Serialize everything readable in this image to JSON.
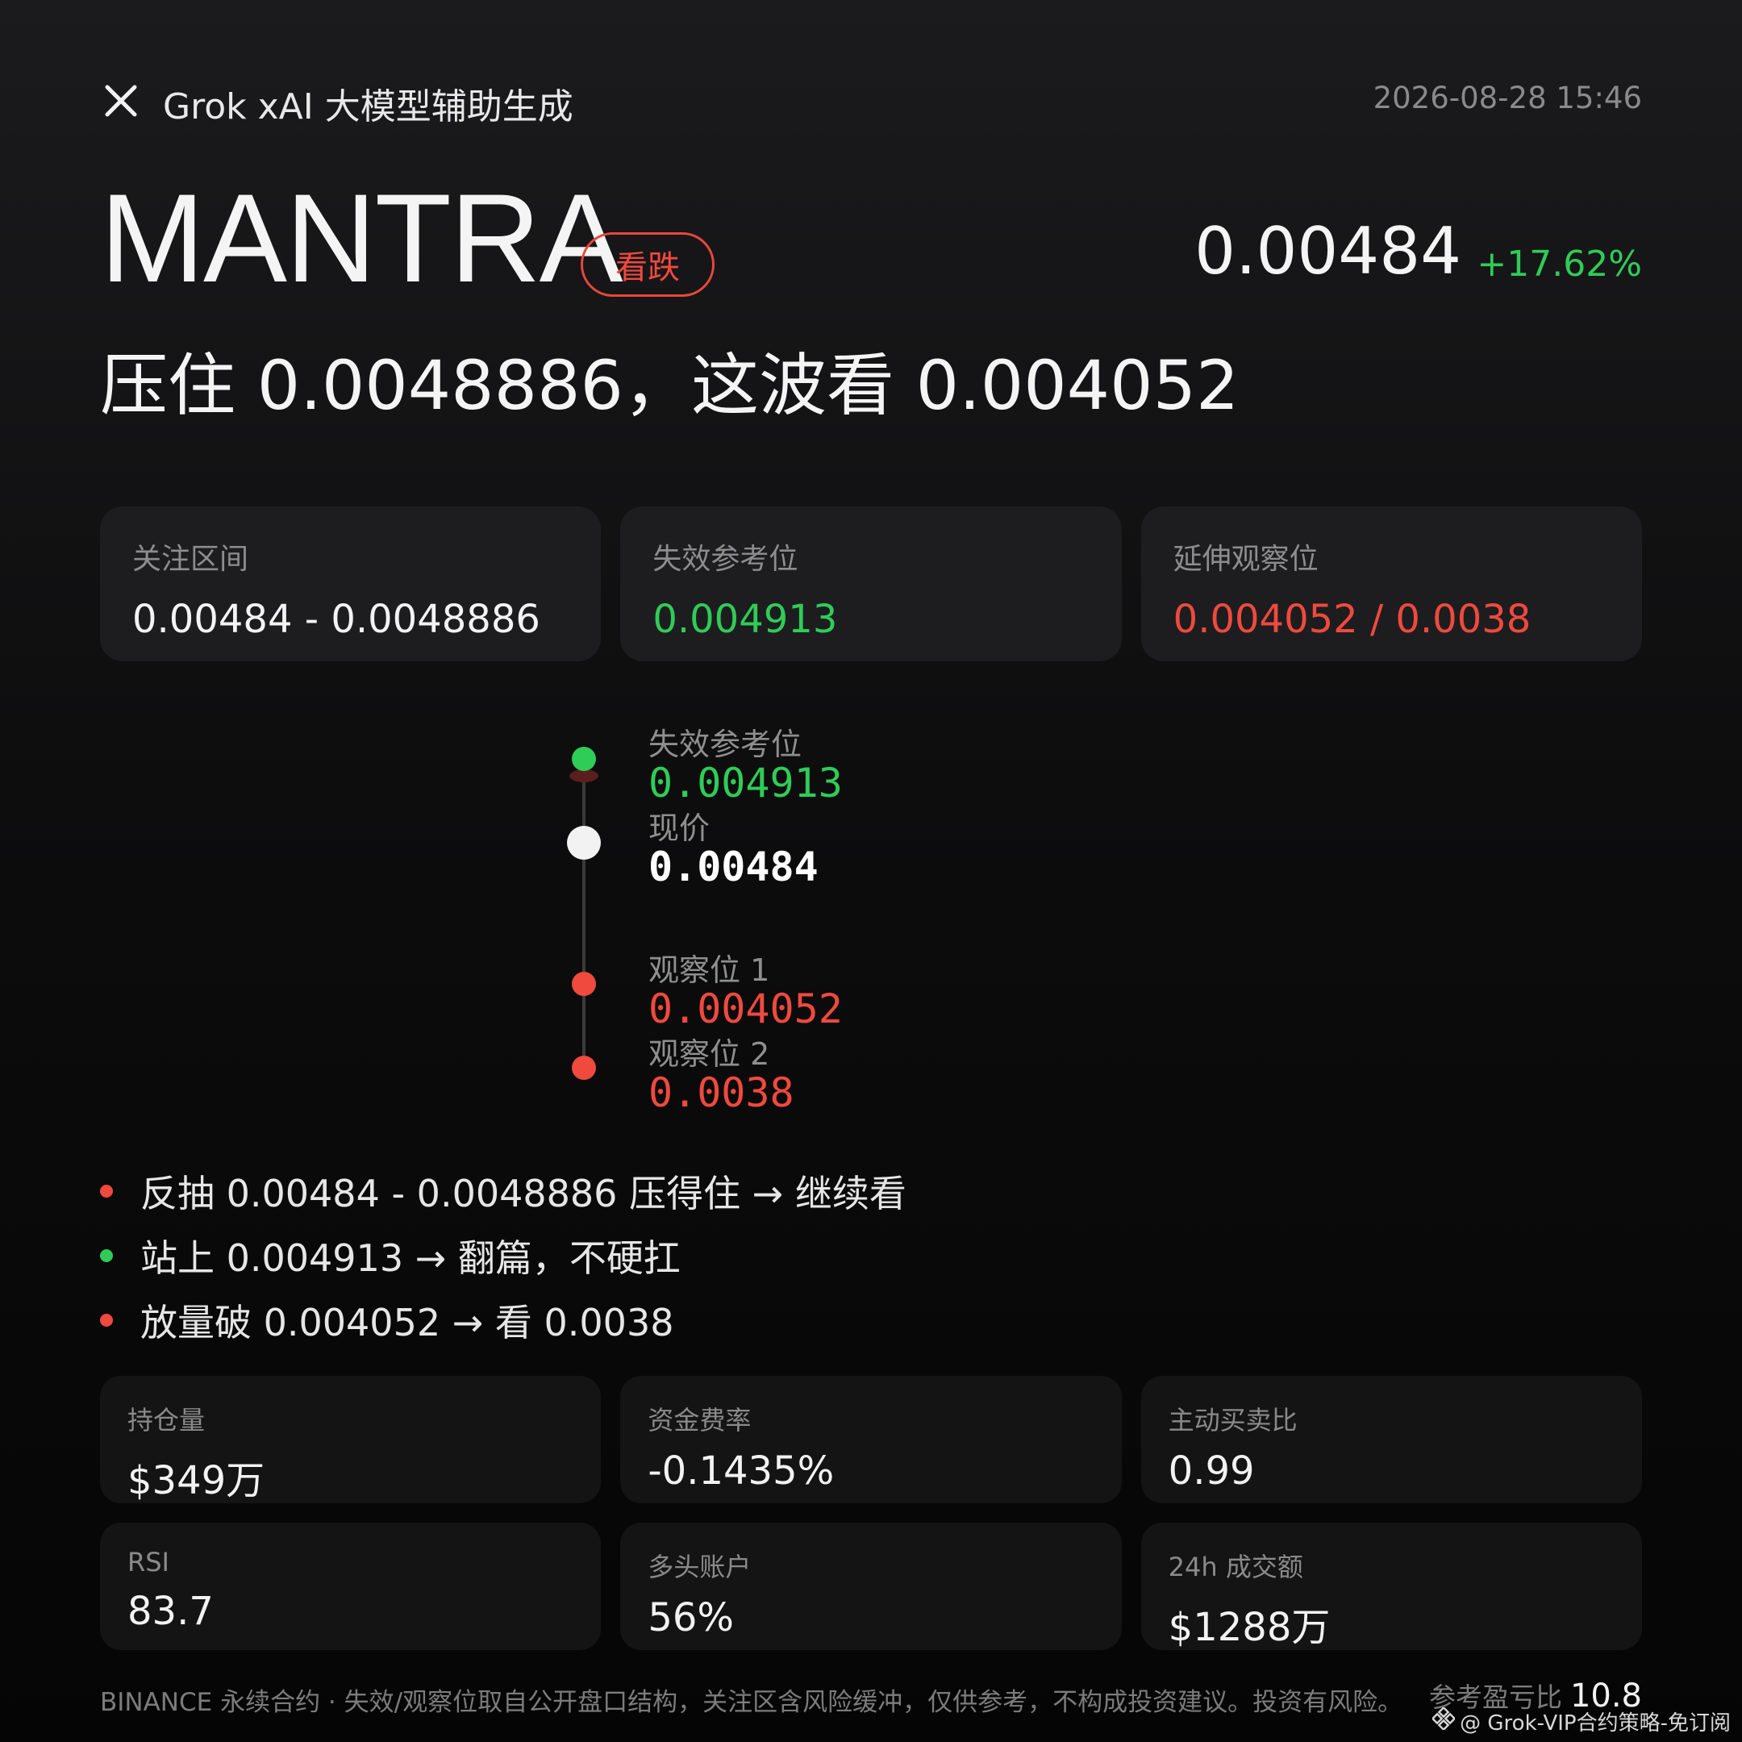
{
  "header": {
    "brand": "Grok xAI 大模型辅助生成",
    "datetime": "2026-08-28 15:46"
  },
  "title": {
    "symbol": "MANTRA",
    "bias": "看跌",
    "price": "0.00484",
    "change": "+17.62%"
  },
  "headline": "压住 0.0048886，这波看 0.004052",
  "cards": [
    {
      "label": "关注区间",
      "value": "0.00484 - 0.0048886",
      "color": "#f3f3f3"
    },
    {
      "label": "失效参考位",
      "value": "0.004913",
      "color": "#2fcc57"
    },
    {
      "label": "延伸观察位",
      "value": "0.004052 / 0.0038",
      "color": "#f0493e"
    }
  ],
  "ladder": [
    {
      "label": "失效参考位",
      "value": "0.004913",
      "color": "#2fcc57"
    },
    {
      "label": "现价",
      "value": "0.00484",
      "color": "#ffffff"
    },
    {
      "label": "观察位 1",
      "value": "0.004052",
      "color": "#f0493e"
    },
    {
      "label": "观察位 2",
      "value": "0.0038",
      "color": "#f0493e"
    }
  ],
  "bullets": [
    {
      "text": "反抽 0.00484 - 0.0048886 压得住 → 继续看",
      "color": "#f0493e"
    },
    {
      "text": "站上 0.004913 → 翻篇，不硬扛",
      "color": "#2fcc57"
    },
    {
      "text": "放量破 0.004052 → 看 0.0038",
      "color": "#f0493e"
    }
  ],
  "metrics": [
    {
      "label": "持仓量",
      "value": "$349万"
    },
    {
      "label": "资金费率",
      "value": "-0.1435%"
    },
    {
      "label": "主动买卖比",
      "value": "0.99"
    },
    {
      "label": "RSI",
      "value": "83.7"
    },
    {
      "label": "多头账户",
      "value": "56%"
    },
    {
      "label": "24h 成交额",
      "value": "$1288万"
    }
  ],
  "footer": {
    "disclaimer": "BINANCE 永续合约 · 失效/观察位取自公开盘口结构，关注区含风险缓冲，仅供参考，不构成投资建议。投资有风险。",
    "ratio_label": "参考盈亏比",
    "ratio_value": "10.8",
    "watermark": "@ Grok-VIP合约策略-免订阅"
  },
  "icons": {
    "close": "close-icon",
    "watermark": "binance-logo-icon"
  }
}
